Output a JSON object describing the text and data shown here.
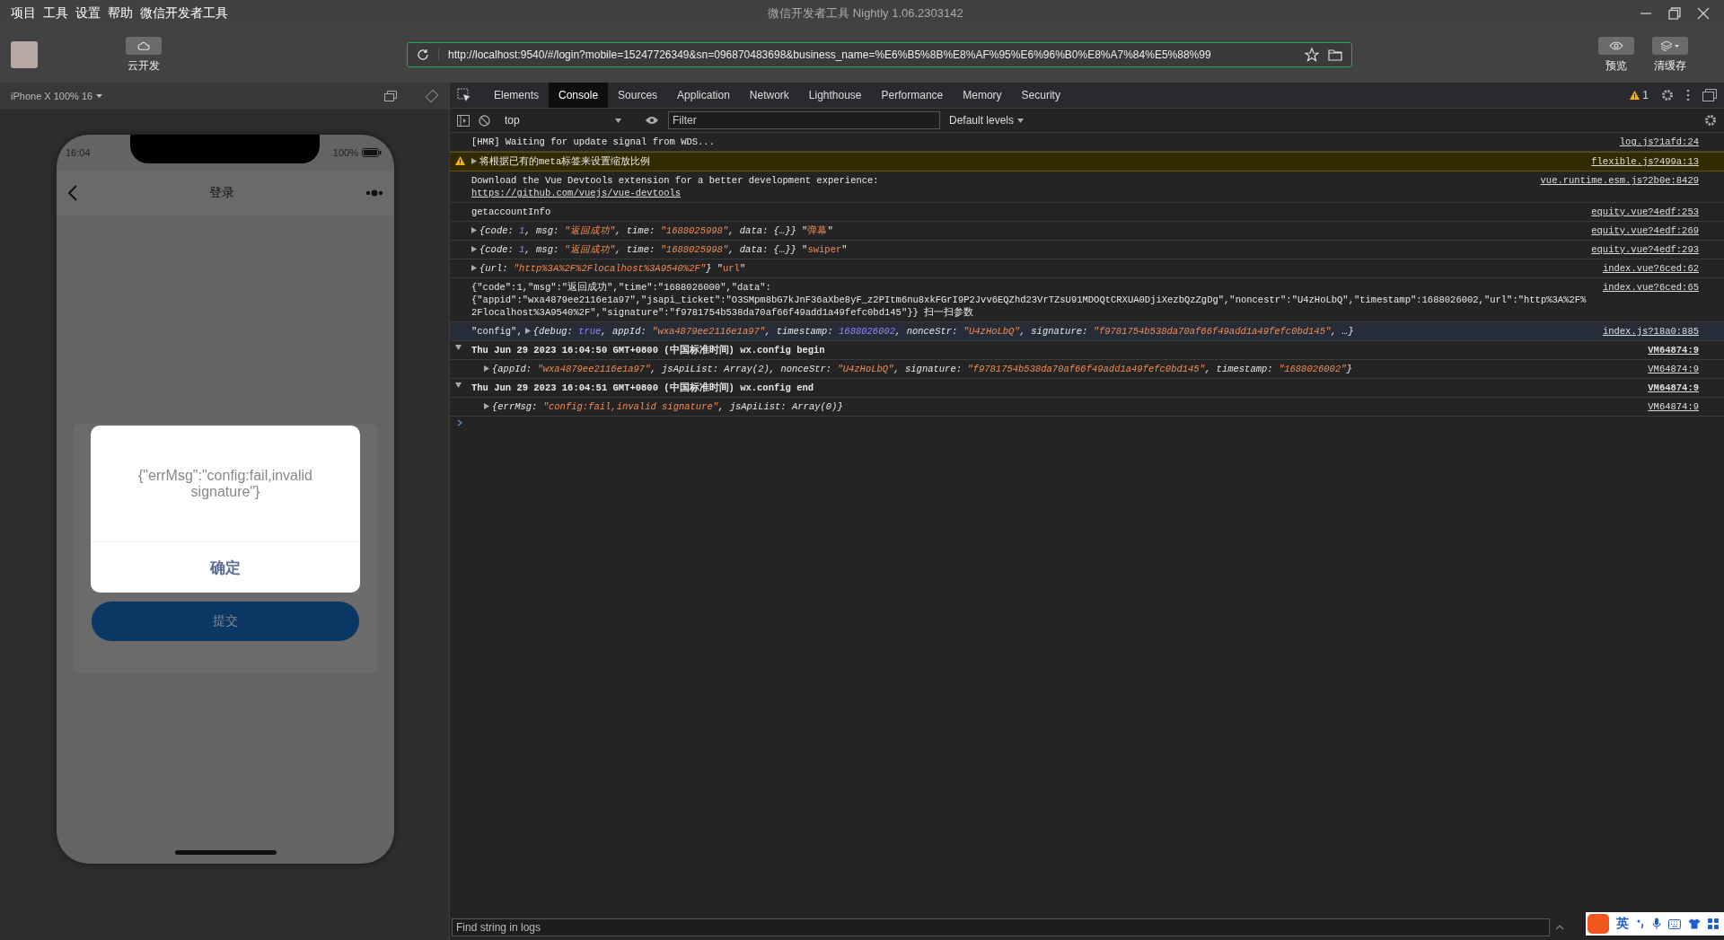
{
  "window": {
    "title": "微信开发者工具 Nightly 1.06.2303142"
  },
  "menu": [
    "项目",
    "工具",
    "设置",
    "帮助",
    "微信开发者工具"
  ],
  "toolbar": {
    "cloud_button": "云开发",
    "address": "http://localhost:9540/#/login?mobile=15247726349&sn=096870483698&business_name=%E6%B5%8B%E8%AF%95%E6%96%B0%E8%A7%84%E5%88%99",
    "preview_button": "预览",
    "clear_cache_button": "清缓存"
  },
  "simulator": {
    "device": "iPhone X 100% 16",
    "status_time": "16:04",
    "battery": "100%",
    "page_title": "登录",
    "dialog": {
      "message": "{\"errMsg\":\"config:fail,invalid signature\"}",
      "confirm": "确定"
    },
    "submit_button": "提交"
  },
  "devtools": {
    "tabs": [
      {
        "label": "Elements",
        "selected": false
      },
      {
        "label": "Console",
        "selected": true
      },
      {
        "label": "Sources",
        "selected": false
      },
      {
        "label": "Application",
        "selected": false
      },
      {
        "label": "Network",
        "selected": false
      },
      {
        "label": "Lighthouse",
        "selected": false
      },
      {
        "label": "Performance",
        "selected": false
      },
      {
        "label": "Memory",
        "selected": false
      },
      {
        "label": "Security",
        "selected": false
      }
    ],
    "warning_count": "1",
    "context": "top",
    "filter": {
      "placeholder": "Filter"
    },
    "levels": "Default levels",
    "console": [
      {
        "kind": "log",
        "selected": false,
        "parts": [
          {
            "kind": "plain",
            "text": "[HMR] Waiting for update signal from WDS..."
          }
        ],
        "source": "log.js?1afd:24"
      },
      {
        "kind": "warning",
        "selected": false,
        "expanded": false,
        "parts": [
          {
            "kind": "plain",
            "text": "将根据已有的meta标签来设置缩放比例"
          }
        ],
        "source": "flexible.js?499a:13"
      },
      {
        "kind": "log",
        "selected": false,
        "parts": [
          {
            "kind": "plain",
            "text": "Download the Vue Devtools extension for a better development experience:"
          }
        ],
        "link": "https://github.com/vuejs/vue-devtools",
        "source": "vue.runtime.esm.js?2b0e:8429"
      },
      {
        "kind": "log",
        "selected": false,
        "parts": [
          {
            "kind": "plain",
            "text": "getaccountInfo"
          }
        ],
        "source": "equity.vue?4edf:253"
      },
      {
        "kind": "log",
        "selected": false,
        "expanded": false,
        "parts": [
          {
            "kind": "italic",
            "text": "{code: "
          },
          {
            "kind": "number",
            "text": "1"
          },
          {
            "kind": "italic",
            "text": ", msg: "
          },
          {
            "kind": "string",
            "text": "\"返回成功\""
          },
          {
            "kind": "italic",
            "text": ", time: "
          },
          {
            "kind": "string",
            "text": "\"1688025998\""
          },
          {
            "kind": "italic",
            "text": ", data: {…}}"
          },
          {
            "kind": "plain",
            "text": " \""
          },
          {
            "kind": "quoted",
            "text": "弹幕"
          },
          {
            "kind": "plain",
            "text": "\""
          }
        ],
        "source": "equity.vue?4edf:269"
      },
      {
        "kind": "log",
        "selected": false,
        "expanded": false,
        "parts": [
          {
            "kind": "italic",
            "text": "{code: "
          },
          {
            "kind": "number",
            "text": "1"
          },
          {
            "kind": "italic",
            "text": ", msg: "
          },
          {
            "kind": "string",
            "text": "\"返回成功\""
          },
          {
            "kind": "italic",
            "text": ", time: "
          },
          {
            "kind": "string",
            "text": "\"1688025998\""
          },
          {
            "kind": "italic",
            "text": ", data: {…}}"
          },
          {
            "kind": "plain",
            "text": " \""
          },
          {
            "kind": "quoted",
            "text": "swiper"
          },
          {
            "kind": "plain",
            "text": "\""
          }
        ],
        "source": "equity.vue?4edf:293"
      },
      {
        "kind": "log",
        "selected": false,
        "expanded": false,
        "parts": [
          {
            "kind": "italic",
            "text": "{url: "
          },
          {
            "kind": "string",
            "text": "\"http%3A%2F%2Flocalhost%3A9540%2F\""
          },
          {
            "kind": "italic",
            "text": "}"
          },
          {
            "kind": "plain",
            "text": " \""
          },
          {
            "kind": "quoted",
            "text": "url"
          },
          {
            "kind": "plain",
            "text": "\""
          }
        ],
        "source": "index.vue?6ced:62"
      },
      {
        "kind": "log",
        "selected": false,
        "parts": [
          {
            "kind": "plain",
            "text": "{\"code\":1,\"msg\":\"返回成功\",\"time\":\"1688026000\",\"data\":\n{\"appid\":\"wxa4879ee2116e1a97\",\"jsapi_ticket\":\"O3SMpm8bG7kJnF36aXbe8yF_z2PItm6nu8xkFGrI9P2Jvv6EQZhd23VrTZsU91MDOQtCRXUA0DjiXezbQzZgDg\",\"noncestr\":\"U4zHoLbQ\",\"timestamp\":1688026002,\"url\":\"http%3A%2F%2Flocalhost%3A9540%2F\",\"signature\":\"f9781754b538da70af66f49add1a49fefc0bd145\"}} 扫一扫参数"
          }
        ],
        "source": "index.vue?6ced:65"
      },
      {
        "kind": "log",
        "selected": true,
        "prefix": "\"config\",",
        "expanded": false,
        "parts": [
          {
            "kind": "italic",
            "text": "{debug: "
          },
          {
            "kind": "number",
            "text": "true"
          },
          {
            "kind": "italic",
            "text": ", appId: "
          },
          {
            "kind": "string",
            "text": "\"wxa4879ee2116e1a97\""
          },
          {
            "kind": "italic",
            "text": ", timestamp: "
          },
          {
            "kind": "number",
            "text": "1688026002"
          },
          {
            "kind": "italic",
            "text": ", nonceStr: "
          },
          {
            "kind": "string",
            "text": "\"U4zHoLbQ\""
          },
          {
            "kind": "italic",
            "text": ", signature: "
          },
          {
            "kind": "string",
            "text": "\"f9781754b538da70af66f49add1a49fefc0bd145\""
          },
          {
            "kind": "italic",
            "text": ", …}"
          }
        ],
        "source": "index.js?18a0:885"
      },
      {
        "kind": "group",
        "selected": false,
        "expanded": true,
        "parts": [
          {
            "kind": "bold",
            "text": "Thu Jun 29 2023 16:04:50 GMT+0800 (中国标准时间) wx.config begin"
          }
        ],
        "source": "VM64874:9",
        "children": [
          {
            "kind": "log",
            "selected": false,
            "expanded": false,
            "parts": [
              {
                "kind": "italic",
                "text": "{appId: "
              },
              {
                "kind": "string",
                "text": "\"wxa4879ee2116e1a97\""
              },
              {
                "kind": "italic",
                "text": ", jsApiList: Array(2), nonceStr: "
              },
              {
                "kind": "string",
                "text": "\"U4zHoLbQ\""
              },
              {
                "kind": "italic",
                "text": ", signature: "
              },
              {
                "kind": "string",
                "text": "\"f9781754b538da70af66f49add1a49fefc0bd145\""
              },
              {
                "kind": "italic",
                "text": ", timestamp: "
              },
              {
                "kind": "string",
                "text": "\"1688026002\""
              },
              {
                "kind": "italic",
                "text": "}"
              }
            ],
            "source": "VM64874:9"
          }
        ]
      },
      {
        "kind": "group",
        "selected": false,
        "expanded": true,
        "parts": [
          {
            "kind": "bold",
            "text": "Thu Jun 29 2023 16:04:51 GMT+0800 (中国标准时间) wx.config end"
          }
        ],
        "source": "VM64874:9",
        "children": [
          {
            "kind": "log",
            "selected": false,
            "expanded": false,
            "parts": [
              {
                "kind": "italic",
                "text": "{errMsg: "
              },
              {
                "kind": "string",
                "text": "\"config:fail,invalid signature\""
              },
              {
                "kind": "italic",
                "text": ", jsApiList: Array(0)}"
              }
            ],
            "source": "VM64874:9"
          }
        ]
      }
    ],
    "find": {
      "placeholder": "Find string in logs"
    }
  },
  "ime": {
    "label": "英"
  }
}
